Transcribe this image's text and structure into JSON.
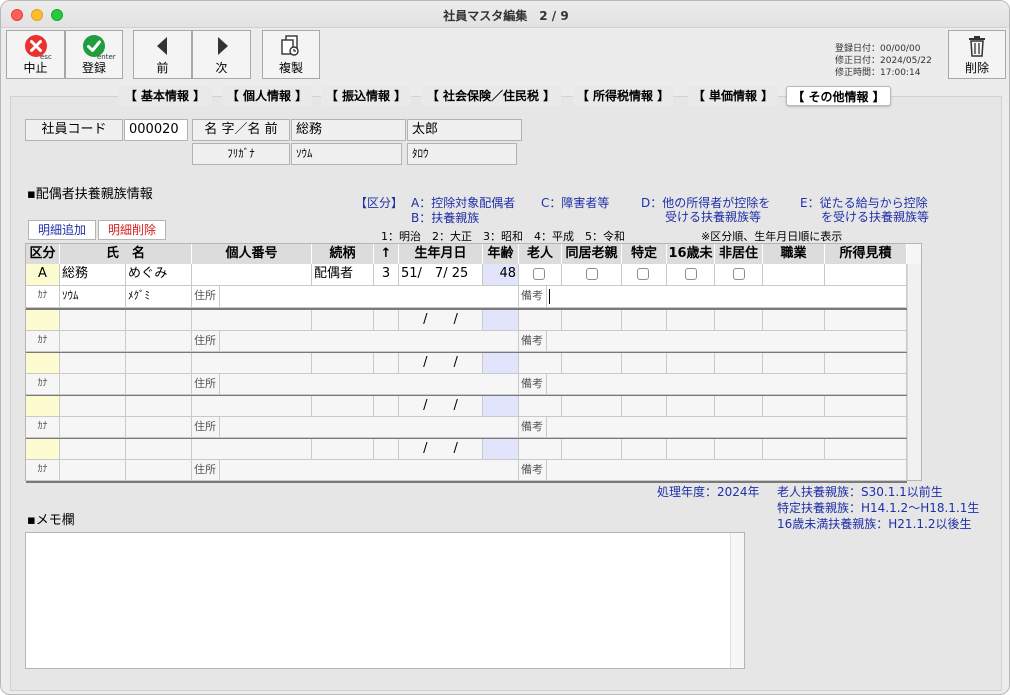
{
  "window": {
    "title": "社員マスタ編集　2 / 9"
  },
  "toolbar": {
    "cancel": {
      "label": "中止",
      "sub": "esc"
    },
    "register": {
      "label": "登録",
      "sub": "enter"
    },
    "prev": {
      "label": "前"
    },
    "next": {
      "label": "次"
    },
    "copy": {
      "label": "複製"
    },
    "delete": {
      "label": "削除"
    }
  },
  "record_info": {
    "registered": "登録日付：00/00/00",
    "modified": "修正日付：2024/05/22",
    "modified_time": "修正時間：17:00:14"
  },
  "tabs": [
    "【 基本情報 】",
    "【 個人情報 】",
    "【 振込情報 】",
    "【 社会保険／住民税 】",
    "【 所得税情報 】",
    "【 単価情報 】",
    "【 その他情報 】"
  ],
  "employee": {
    "code_label": "社員コード",
    "code": "000020",
    "name_label": "名 字／名 前",
    "last_name": "総務",
    "first_name": "太郎",
    "kana_label": "ﾌﾘｶﾞﾅ",
    "last_kana": "ｿｳﾑ",
    "first_kana": "ﾀﾛｳ"
  },
  "dependents": {
    "section_title": "▪配偶者扶養親族情報",
    "legend": {
      "key": "【区分】",
      "a": "A：控除対象配偶者",
      "b": "B：扶養親族",
      "c": "C：障害者等",
      "d1": "D：他の所得者が控除を",
      "d2": "受ける扶養親族等",
      "e1": "E：従たる給与から控除",
      "e2": "を受ける扶養親族等",
      "era": "1：明治　2：大正　3：昭和　4：平成　5：令和",
      "note": "※区分順、生年月日順に表示"
    },
    "add_button": "明細追加",
    "delete_button": "明細削除",
    "headers": [
      "区分",
      "氏　名",
      "個人番号",
      "続柄",
      "↑",
      "生年月日",
      "年齢",
      "老人",
      "同居老親",
      "特定",
      "16歳未",
      "非居住",
      "職業",
      "所得見積"
    ],
    "row_labels": {
      "kana": "ｶﾅ",
      "address": "住所",
      "remarks": "備考",
      "date_sep": "/　　/"
    },
    "rows": [
      {
        "category": "A",
        "last_name": "総務",
        "first_name": "めぐみ",
        "number": "",
        "relation": "配偶者",
        "era": "3",
        "birth": "51/　7/ 25",
        "age": "48",
        "last_kana": "ｿｳﾑ",
        "first_kana": "ﾒｸﾞﾐ"
      }
    ]
  },
  "footer": {
    "fiscal_year": "処理年度：2024年",
    "elderly": "老人扶養親族：S30.1.1以前生",
    "specific": "特定扶養親族：H14.1.2～H18.1.1生",
    "under16": "16歳未満扶養親族：H21.1.2以後生"
  },
  "memo": {
    "title": "▪メモ欄",
    "value": ""
  }
}
